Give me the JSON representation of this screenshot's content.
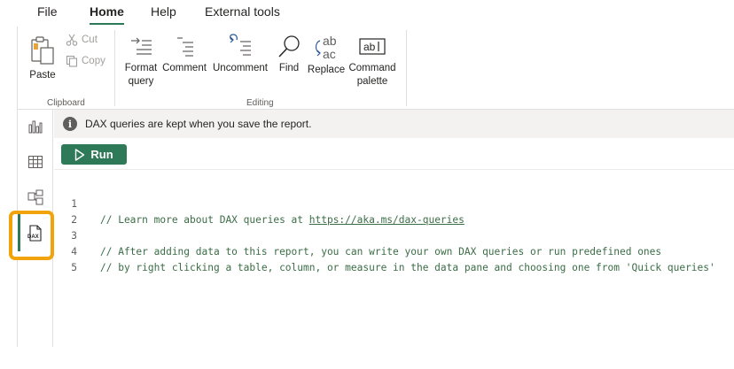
{
  "menu": {
    "tabs": [
      {
        "label": "File"
      },
      {
        "label": "Home"
      },
      {
        "label": "Help"
      },
      {
        "label": "External tools"
      }
    ],
    "active_tab": "Home"
  },
  "ribbon": {
    "clipboard": {
      "paste_label": "Paste",
      "cut_label": "Cut",
      "copy_label": "Copy",
      "group_label": "Clipboard"
    },
    "editing": {
      "format_query_label_1": "Format",
      "format_query_label_2": "query",
      "comment_label": "Comment",
      "uncomment_label": "Uncomment",
      "find_label": "Find",
      "replace_label": "Replace",
      "command_palette_label_1": "Command",
      "command_palette_label_2": "palette",
      "group_label": "Editing"
    }
  },
  "leftnav": {
    "items": [
      {
        "icon": "report-view-icon"
      },
      {
        "icon": "table-view-icon"
      },
      {
        "icon": "model-view-icon"
      },
      {
        "icon": "dax-query-view-icon",
        "active": true
      }
    ],
    "dax_icon_text": "DAX"
  },
  "infobar": {
    "icon_text": "i",
    "message": "DAX queries are kept when you save the report."
  },
  "run_button": {
    "label": "Run"
  },
  "editor": {
    "lines": [
      {
        "number": "1",
        "prefix": "// Learn more about DAX queries at ",
        "link": "https://aka.ms/dax-queries"
      },
      {
        "number": "2",
        "text": ""
      },
      {
        "number": "3",
        "text": "// After adding data to this report, you can write your own DAX queries or run predefined ones"
      },
      {
        "number": "4",
        "text": "// by right clicking a table, column, or measure in the data pane and choosing one from 'Quick queries'"
      },
      {
        "number": "5",
        "text": ""
      }
    ]
  },
  "colors": {
    "accent": "#2e7a58",
    "highlight": "#f0a30a",
    "comment": "#3b6d46"
  }
}
